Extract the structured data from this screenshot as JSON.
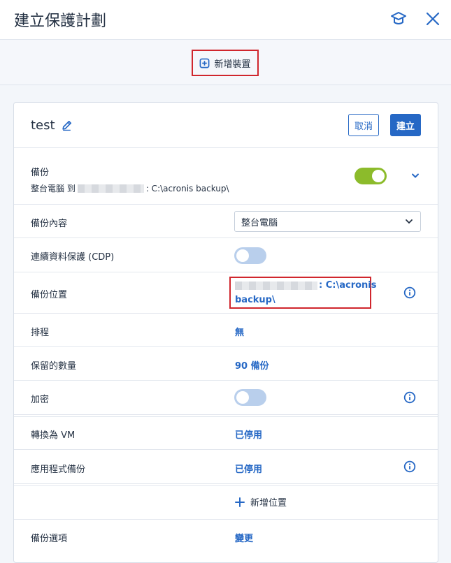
{
  "header": {
    "title": "建立保護計劃",
    "icons": [
      "graduation-cap-icon",
      "close-icon"
    ]
  },
  "add_device_label": "新增裝置",
  "plan": {
    "name": "test",
    "cancel_label": "取消",
    "create_label": "建立"
  },
  "backup_section": {
    "title": "備份",
    "summary_prefix": "整台電腦 到",
    "summary_suffix": ": C:\\acronis backup\\",
    "enabled": true
  },
  "rows": {
    "backup_content": {
      "label": "備份內容",
      "value": "整台電腦"
    },
    "cdp": {
      "label": "連續資料保護 (CDP)",
      "enabled": false
    },
    "location": {
      "label": "備份位置",
      "value_suffix": ": C:\\acronis",
      "value_line2": "backup\\"
    },
    "schedule": {
      "label": "排程",
      "value": "無"
    },
    "retention": {
      "label": "保留的數量",
      "value": "90 備份"
    },
    "encryption": {
      "label": "加密",
      "enabled": false
    },
    "convert_vm": {
      "label": "轉換為 VM",
      "value": "已停用"
    },
    "app_backup": {
      "label": "應用程式備份",
      "value": "已停用"
    },
    "add_location": {
      "label": "新增位置"
    },
    "backup_options": {
      "label": "備份選項",
      "value": "變更"
    }
  },
  "colors": {
    "accent": "#2668c5",
    "toggle_on": "#8cbb2b",
    "toggle_off": "#b9cfec",
    "highlight": "#d0262d"
  }
}
